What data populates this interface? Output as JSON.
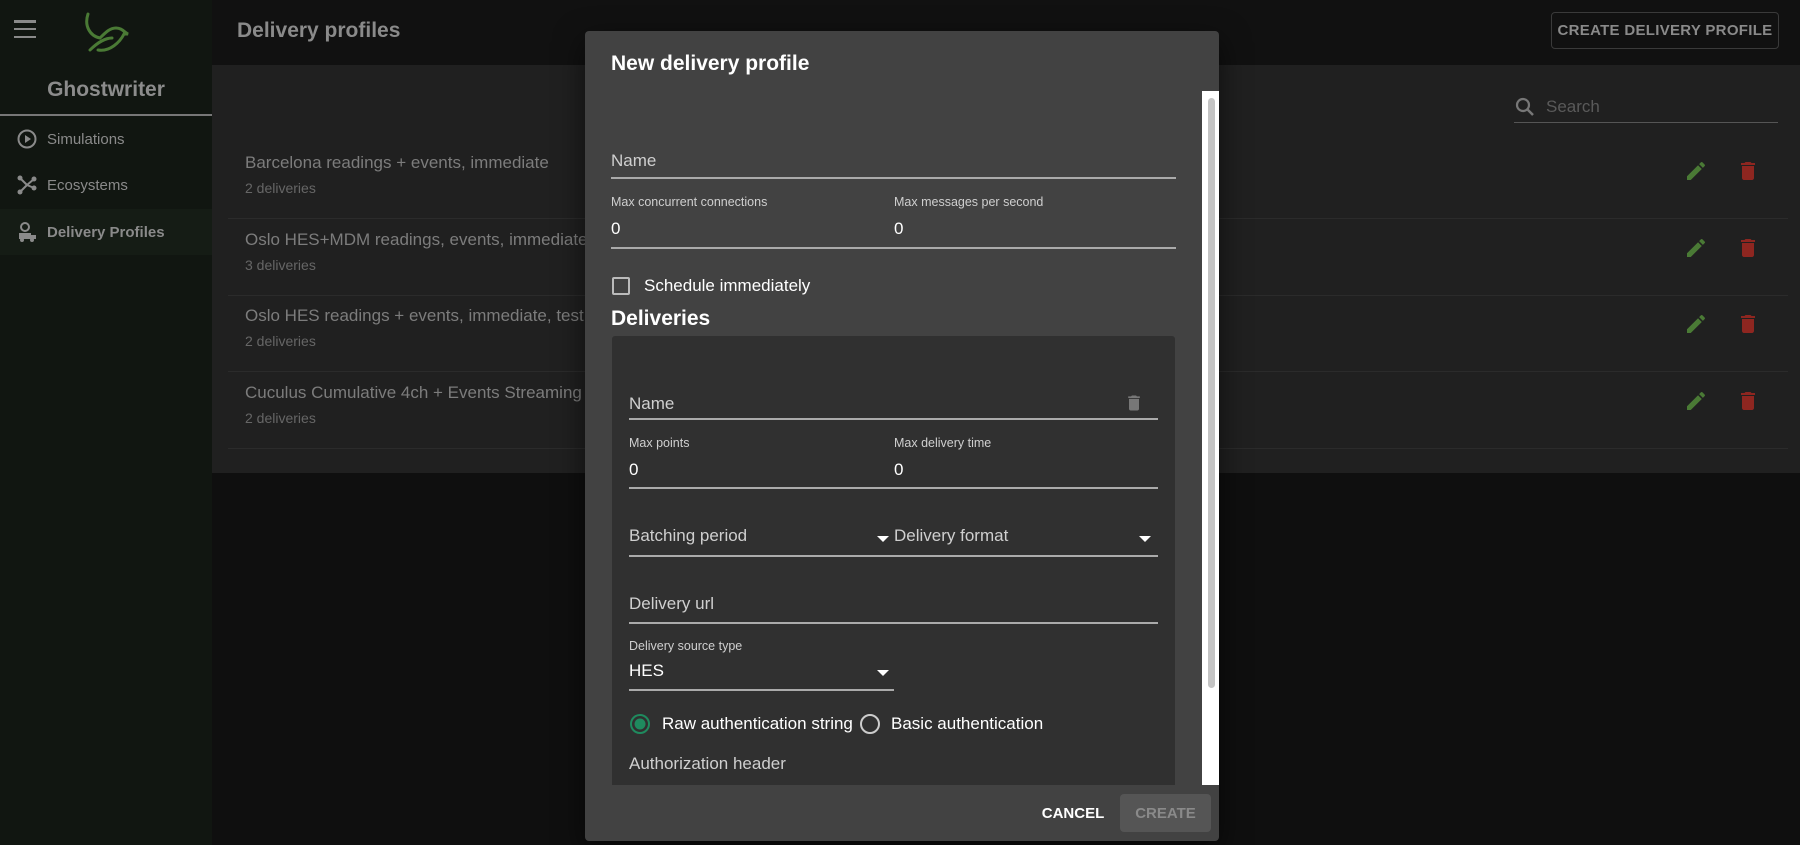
{
  "app": {
    "name": "Ghostwriter"
  },
  "sidebar": {
    "items": [
      {
        "label": "Simulations",
        "icon": "play-circle-icon"
      },
      {
        "label": "Ecosystems",
        "icon": "network-icon"
      },
      {
        "label": "Delivery Profiles",
        "icon": "delivery-truck-icon",
        "active": true
      }
    ]
  },
  "header": {
    "title": "Delivery profiles",
    "create_label": "CREATE DELIVERY PROFILE"
  },
  "search": {
    "placeholder": "Search"
  },
  "profiles": [
    {
      "name": "Barcelona readings + events, immediate",
      "count": "2 deliveries"
    },
    {
      "name": "Oslo HES+MDM readings, events, immediate",
      "count": "3 deliveries"
    },
    {
      "name": "Oslo HES readings + events, immediate, test",
      "count": "2 deliveries"
    },
    {
      "name": "Cuculus Cumulative 4ch + Events Streaming",
      "count": "2 deliveries"
    }
  ],
  "colors": {
    "accent": "#4a7a35",
    "danger": "#8e2620",
    "radio": "#1f8a5e"
  },
  "dialog": {
    "title": "New delivery profile",
    "name_label": "Name",
    "max_conn_label": "Max concurrent connections",
    "max_conn_value": "0",
    "max_msg_label": "Max messages per second",
    "max_msg_value": "0",
    "schedule_label": "Schedule immediately",
    "schedule_checked": false,
    "deliveries_heading": "Deliveries",
    "delivery": {
      "name_label": "Name",
      "max_points_label": "Max points",
      "max_points_value": "0",
      "max_time_label": "Max delivery time",
      "max_time_value": "0",
      "batching_label": "Batching period",
      "format_label": "Delivery format",
      "url_label": "Delivery url",
      "source_label": "Delivery source type",
      "source_value": "HES",
      "auth_raw": "Raw authentication string",
      "auth_basic": "Basic authentication",
      "auth_selected": "raw",
      "auth_header_label": "Authorization header"
    },
    "cancel_label": "CANCEL",
    "create_label": "CREATE"
  }
}
